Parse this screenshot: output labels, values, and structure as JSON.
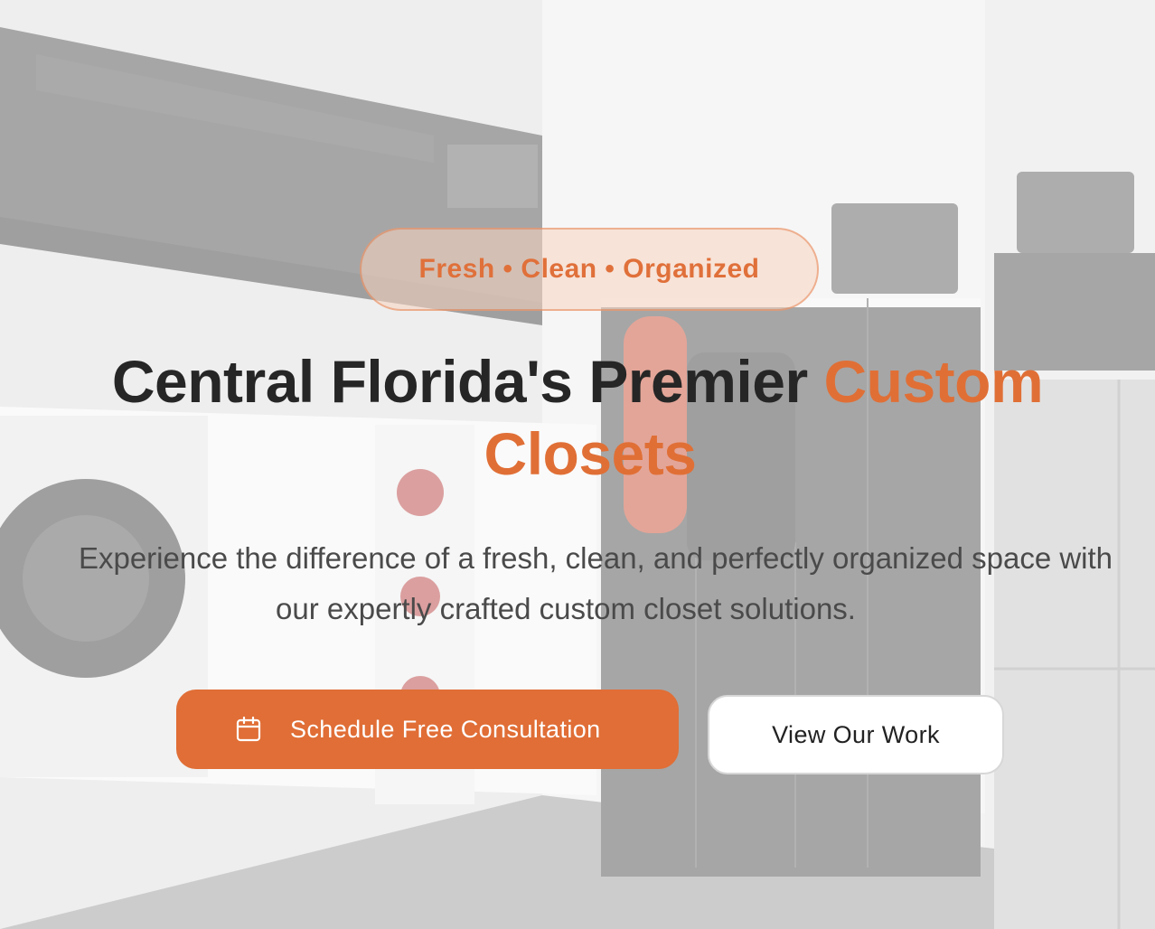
{
  "hero": {
    "tagline": "Fresh • Clean • Organized",
    "headline_main": "Central Florida's Premier ",
    "headline_accent_1": "Custom",
    "headline_accent_2": "Closets",
    "subhead_line1": "Experience the difference of a fresh, clean, and perfectly organized space with",
    "subhead_line2": "our expertly crafted custom closet solutions.",
    "primary_cta": {
      "label": "Schedule Free Consultation",
      "icon": "calendar-icon"
    },
    "secondary_cta": {
      "label": "View Our Work"
    }
  },
  "colors": {
    "accent": "#e06e36",
    "heading": "#262626",
    "body_text": "#4a4a4a",
    "secondary_button_bg": "#ffffff"
  }
}
